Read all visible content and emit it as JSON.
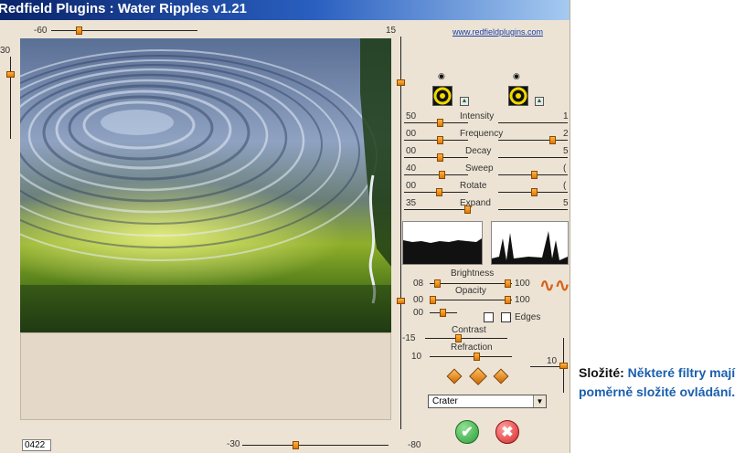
{
  "window": {
    "title": "Redfield Plugins : Water Ripples v1.21",
    "link": "www.redfieldplugins.com"
  },
  "top_slider": {
    "min_label": "-60",
    "max_label": "15"
  },
  "left_slider": {
    "value_label": "30"
  },
  "bottom_slider": {
    "value_label": "-30",
    "field": "0422"
  },
  "right_vslider": {
    "bottom_label": "-80"
  },
  "params": [
    {
      "value": "50",
      "label": "Intensity",
      "right": "1"
    },
    {
      "value": "00",
      "label": "Frequency",
      "right": "2"
    },
    {
      "value": "00",
      "label": "Decay",
      "right": "5"
    },
    {
      "value": "40",
      "label": "Sweep",
      "right": "("
    },
    {
      "value": "00",
      "label": "Rotate",
      "right": "("
    },
    {
      "value": "35",
      "label": "Expand",
      "right": "5"
    }
  ],
  "brightness": {
    "label": "Brightness",
    "left": "08",
    "right": "100"
  },
  "opacity": {
    "label": "Opacity",
    "left": "00",
    "right": "100"
  },
  "third_row": {
    "left": "00"
  },
  "edges": {
    "label": "Edges",
    "checked": false
  },
  "contrast": {
    "label": "Contrast",
    "value": "-15"
  },
  "refraction": {
    "label": "Refraction",
    "value": "10",
    "side_value": "10"
  },
  "preset": {
    "selected": "Crater"
  },
  "caption": {
    "bold": "Složité:",
    "text": "Některé filtry mají poměrně složité ovládání."
  },
  "colors": {
    "accent": "#e07800",
    "caption_blue": "#1a5fae",
    "ok": "#2e9e3e",
    "cancel": "#d62a2a"
  }
}
